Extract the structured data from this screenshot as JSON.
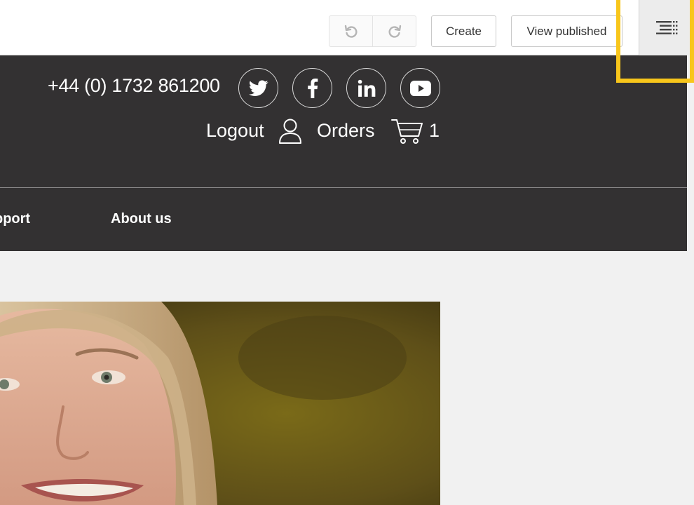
{
  "toolbar": {
    "undo_icon": "undo-icon",
    "redo_icon": "redo-icon",
    "create_label": "Create",
    "view_published_label": "View published",
    "menu_icon": "outline-menu-icon",
    "highlight_color": "#f8c61b"
  },
  "header": {
    "background": "#333132",
    "phone": "+44 (0) 1732 861200",
    "social": [
      "twitter-icon",
      "facebook-icon",
      "linkedin-icon",
      "youtube-icon"
    ],
    "logout_label": "Logout",
    "orders_label": "Orders",
    "cart_count": "1"
  },
  "nav": {
    "items": [
      {
        "label": "pport"
      },
      {
        "label": "About us"
      }
    ]
  },
  "hero": {
    "image": "portrait-photo"
  }
}
